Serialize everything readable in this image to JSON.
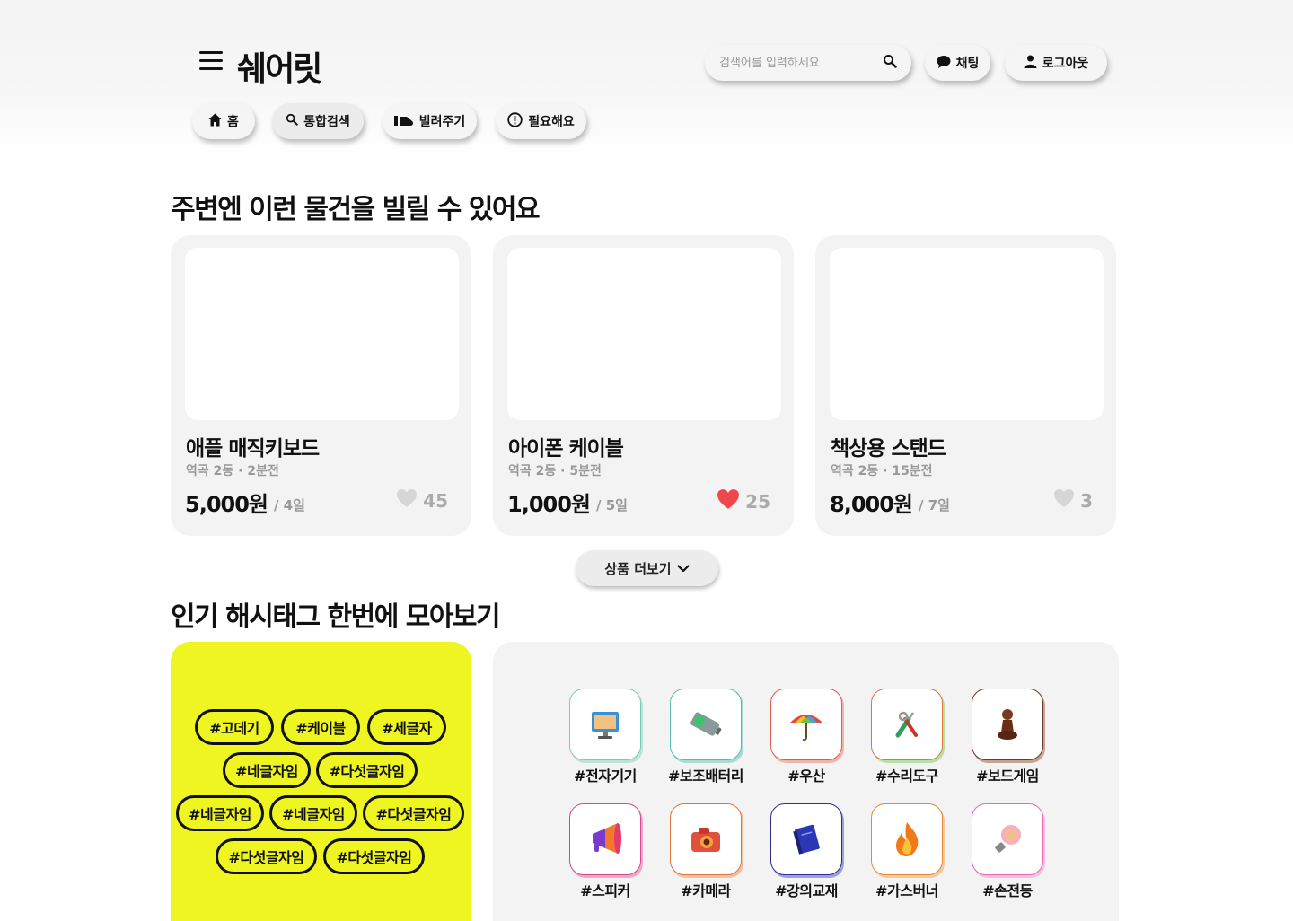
{
  "header": {
    "logo": "쉐어릿",
    "search_placeholder": "검색어를 입력하세요",
    "chat_label": "채팅",
    "logout_label": "로그아웃"
  },
  "nav": [
    {
      "label": "홈",
      "icon": "home-icon"
    },
    {
      "label": "통합검색",
      "icon": "search-icon"
    },
    {
      "label": "빌려주기",
      "icon": "lend-icon"
    },
    {
      "label": "필요해요",
      "icon": "alert-circle-icon"
    }
  ],
  "section1": {
    "title": "주변엔 이런 물건을 빌릴 수 있어요"
  },
  "products": [
    {
      "title": "애플 매직키보드",
      "meta": "역곡 2동 · 2분전",
      "price": "5,000원",
      "period": "/ 4일",
      "likes": "45",
      "liked": false
    },
    {
      "title": "아이폰 케이블",
      "meta": "역곡 2동 · 5분전",
      "price": "1,000원",
      "period": "/ 5일",
      "likes": "25",
      "liked": true
    },
    {
      "title": "책상용 스탠드",
      "meta": "역곡 2동 · 15분전",
      "price": "8,000원",
      "period": "/ 7일",
      "likes": "3",
      "liked": false
    }
  ],
  "more_label": "상품 더보기",
  "section2": {
    "title": "인기 해시태그 한번에 모아보기"
  },
  "hashtags": [
    "#고데기",
    "#케이블",
    "#세글자",
    "#네글자임",
    "#다섯글자임",
    "#네글자임",
    "#네글자임",
    "#다섯글자임",
    "#다섯글자임",
    "#다섯글자임"
  ],
  "categories": [
    {
      "label": "#전자기기",
      "icon": "monitor-icon",
      "border": "#7fc9b5"
    },
    {
      "label": "#보조배터리",
      "icon": "battery-icon",
      "border": "#5ab9a8"
    },
    {
      "label": "#우산",
      "icon": "umbrella-icon",
      "border": "#e05c4a"
    },
    {
      "label": "#수리도구",
      "icon": "tools-icon",
      "border": "#6cae4c"
    },
    {
      "label": "#보드게임",
      "icon": "chess-pawn-icon",
      "border": "#6a3a2a"
    },
    {
      "label": "#스피커",
      "icon": "megaphone-icon",
      "border": "#d14a8f"
    },
    {
      "label": "#카메라",
      "icon": "camera-icon",
      "border": "#e0743a"
    },
    {
      "label": "#강의교재",
      "icon": "book-icon",
      "border": "#2a2f8e"
    },
    {
      "label": "#가스버너",
      "icon": "fire-icon",
      "border": "#e08a3a"
    },
    {
      "label": "#손전등",
      "icon": "bulb-icon",
      "border": "#e86ab2"
    }
  ],
  "colors": {
    "accent_yellow": "#eef520",
    "heart_red": "#f0474a",
    "card_bg": "#f3f3f3"
  }
}
